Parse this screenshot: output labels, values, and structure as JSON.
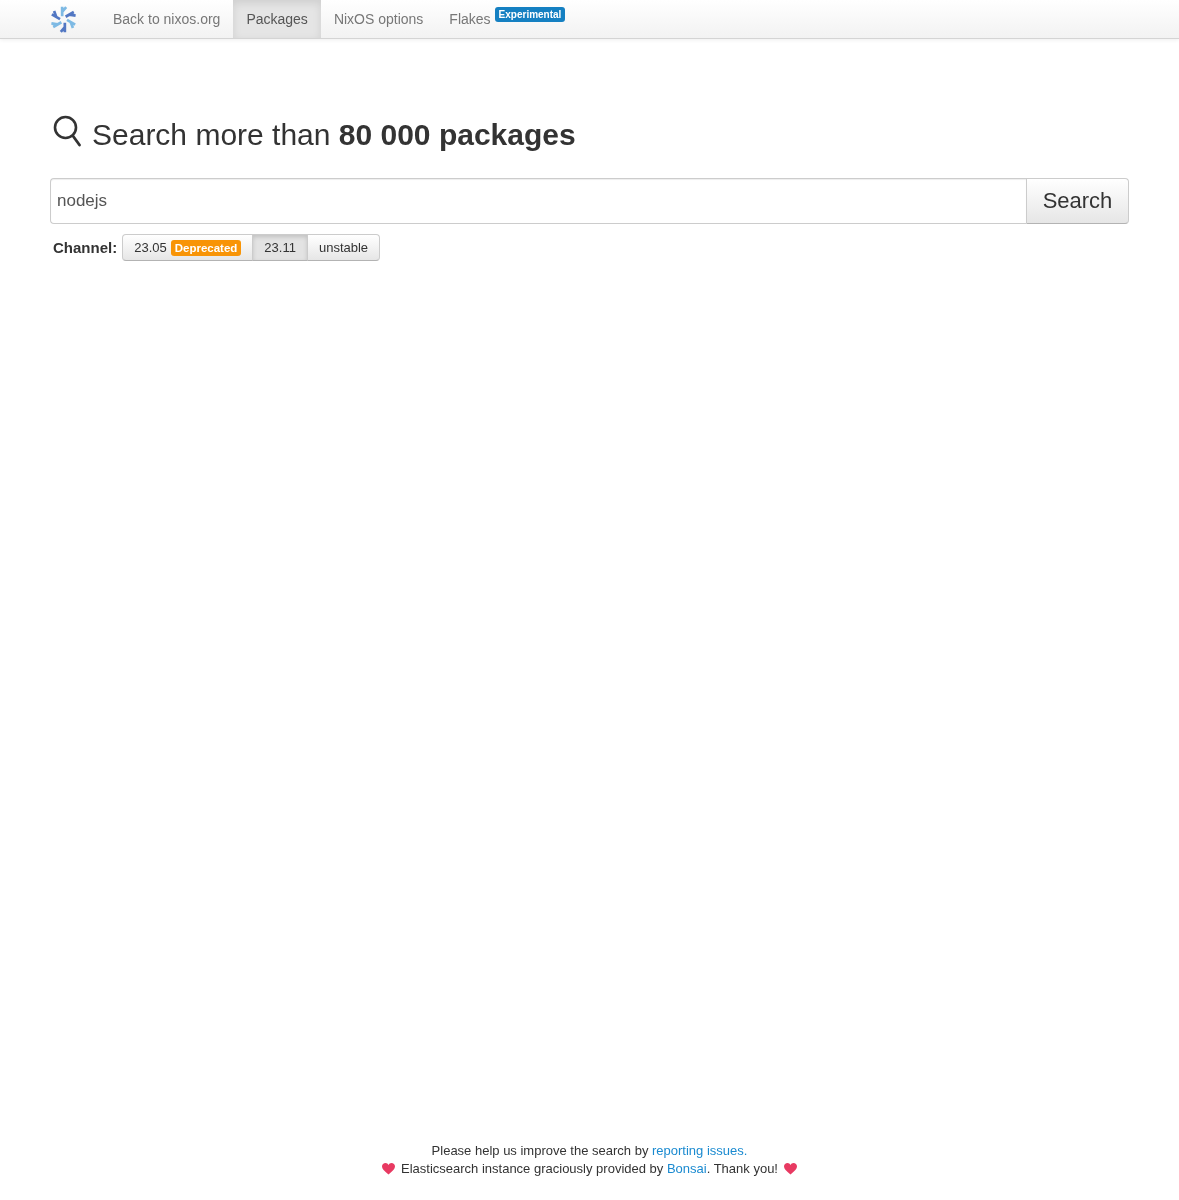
{
  "navbar": {
    "items": [
      {
        "label": "Back to nixos.org",
        "selected": false
      },
      {
        "label": "Packages",
        "selected": true
      },
      {
        "label": "NixOS options",
        "selected": false
      },
      {
        "label": "Flakes",
        "selected": false,
        "badge": "Experimental"
      }
    ]
  },
  "heading": "Search more than **80 000 packages**",
  "search": {
    "value": "nodejs",
    "button": "Search"
  },
  "channel": {
    "label": "Channel:",
    "options": [
      {
        "label": "23.05",
        "badge": "Deprecated",
        "selected": false
      },
      {
        "label": "23.11",
        "selected": true
      },
      {
        "label": "unstable",
        "selected": false
      }
    ]
  },
  "footer": {
    "notice": {
      "text": "Please help us improve the search by",
      "link": "reporting issues."
    },
    "credit": {
      "text": "Elasticsearch instance graciously provided by",
      "link": "Bonsai",
      "text_after": ". Thank you!"
    }
  }
}
